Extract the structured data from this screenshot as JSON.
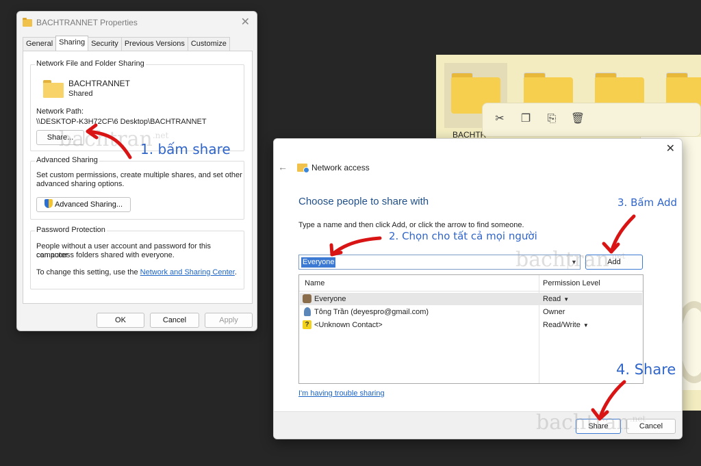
{
  "explorer": {
    "folder_label": "BACHTR",
    "toolbar_icons": [
      "cut-icon",
      "copy-icon",
      "rename-icon",
      "delete-icon"
    ]
  },
  "properties": {
    "title": "BACHTRANNET Properties",
    "tabs": [
      "General",
      "Sharing",
      "Security",
      "Previous Versions",
      "Customize"
    ],
    "active_tab": "Sharing",
    "network_group": {
      "legend": "Network File and Folder Sharing",
      "folder_name": "BACHTRANNET",
      "status": "Shared",
      "path_label": "Network Path:",
      "path_value": "\\\\DESKTOP-K3H72CF\\6 Desktop\\BACHTRANNET",
      "share_button": "Share..."
    },
    "advanced_group": {
      "legend": "Advanced Sharing",
      "desc_line1": "Set custom permissions, create multiple shares, and set other",
      "desc_line2": "advanced sharing options.",
      "button": "Advanced Sharing..."
    },
    "password_group": {
      "legend": "Password Protection",
      "desc_line1": "People without a user account and password for this computer",
      "desc_line2": "can access folders shared with everyone.",
      "change_prefix": "To change this setting, use the ",
      "change_link": "Network and Sharing Center",
      "change_suffix": "."
    },
    "buttons": {
      "ok": "OK",
      "cancel": "Cancel",
      "apply": "Apply"
    }
  },
  "network_access": {
    "header": "Network access",
    "heading": "Choose people to share with",
    "instruction": "Type a name and then click Add, or click the arrow to find someone.",
    "combo_value": "Everyone",
    "add_button": "Add",
    "columns": {
      "name": "Name",
      "permission": "Permission Level"
    },
    "rows": [
      {
        "name": "Everyone",
        "permission": "Read",
        "dropdown": true
      },
      {
        "name": "Tông Trần (deyespro@gmail.com)",
        "permission": "Owner",
        "dropdown": false
      },
      {
        "name": "<Unknown Contact>",
        "permission": "Read/Write",
        "dropdown": true
      }
    ],
    "trouble_link": "I'm having trouble sharing",
    "share_button": "Share",
    "cancel_button": "Cancel"
  },
  "annotations": {
    "step1": "1. bấm share",
    "step2": "2. Chọn cho tất cả mọi người",
    "step3": "3. Bấm Add",
    "step4": "4. Share"
  },
  "watermark": {
    "text": "bachtran",
    "sub": ".net"
  },
  "colors": {
    "annotation": "#2f65c9",
    "arrow": "#d81414",
    "accent": "#3b79d2"
  }
}
